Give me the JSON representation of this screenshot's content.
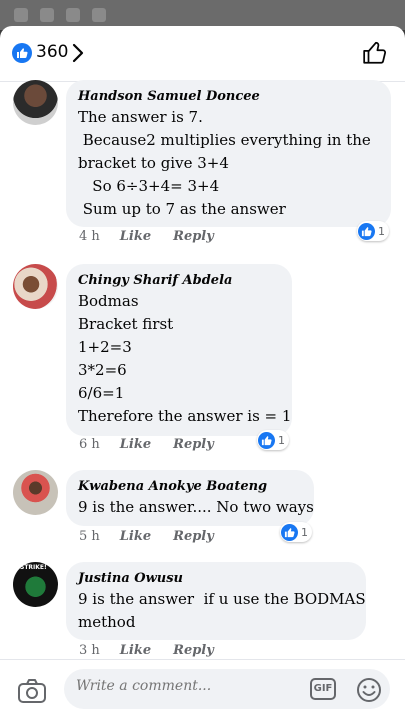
{
  "header": {
    "like_count": "360"
  },
  "comments": [
    {
      "author": "Handson Samuel Doncee",
      "text": "The answer is 7.\n Because2 multiplies everything in the\nbracket to give 3+4\n   So 6÷3+4= 3+4\n Sum up to 7 as the answer",
      "time": "4 h",
      "like_label": "Like",
      "reply_label": "Reply",
      "reactions": "1"
    },
    {
      "author": "Chingy Sharif Abdela",
      "text": "Bodmas\nBracket first\n1+2=3\n3*2=6\n6/6=1\nTherefore the answer is = 1",
      "time": "6 h",
      "like_label": "Like",
      "reply_label": "Reply",
      "reactions": "1"
    },
    {
      "author": "Kwabena Anokye Boateng",
      "text": "9 is the answer.... No two ways",
      "time": "5 h",
      "like_label": "Like",
      "reply_label": "Reply",
      "reactions": "1"
    },
    {
      "author": "Justina Owusu",
      "text": "9 is the answer  if u use the BODMAS\nmethod",
      "time": "3 h",
      "like_label": "Like",
      "reply_label": "Reply",
      "avatar_text": "STRIKE!"
    }
  ],
  "composer": {
    "placeholder": "Write a comment...",
    "gif_label": "GIF"
  },
  "colors": {
    "accent": "#1877f2",
    "bubble": "#f0f2f5",
    "meta": "#65676b"
  }
}
